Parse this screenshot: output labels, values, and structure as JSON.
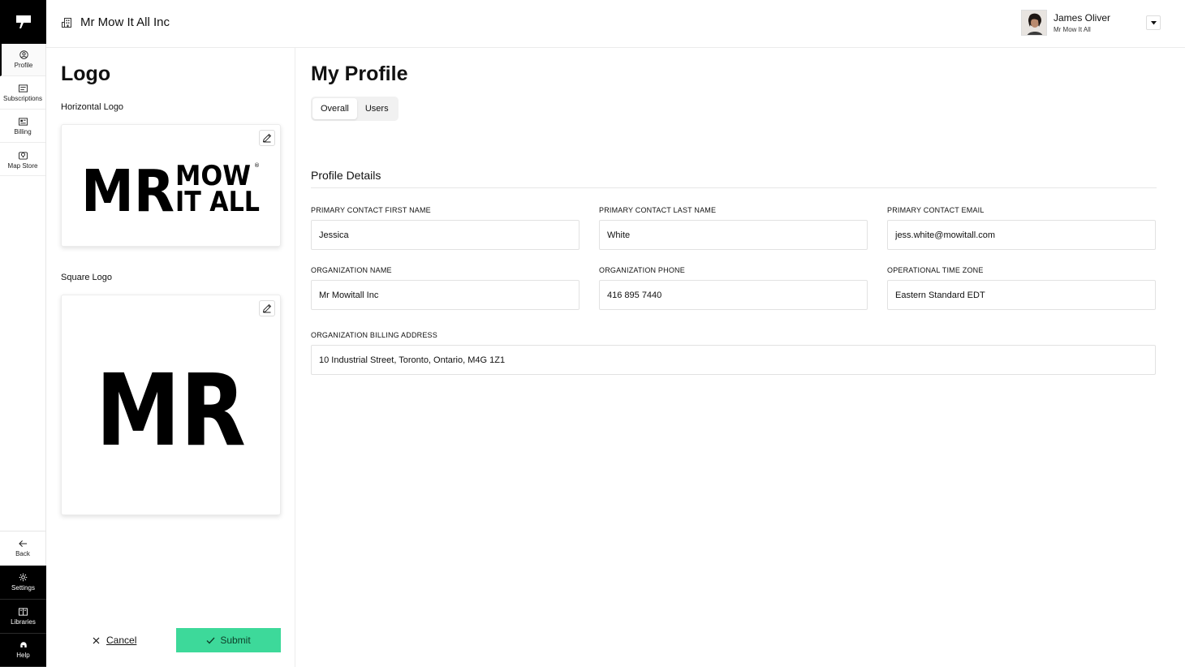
{
  "nav": {
    "items": [
      {
        "label": "Profile",
        "icon": "user-circle-icon"
      },
      {
        "label": "Subscriptions",
        "icon": "list-icon"
      },
      {
        "label": "Billing",
        "icon": "billing-icon"
      },
      {
        "label": "Map Store",
        "icon": "map-pin-icon"
      }
    ],
    "back_label": "Back",
    "bottom": [
      {
        "label": "Settings",
        "icon": "gear-icon"
      },
      {
        "label": "Libraries",
        "icon": "book-icon"
      },
      {
        "label": "Help",
        "icon": "help-icon"
      }
    ]
  },
  "header": {
    "org_name": "Mr Mow It All Inc",
    "user_name": "James Oliver",
    "user_org": "Mr Mow It All"
  },
  "logo_panel": {
    "title": "Logo",
    "horizontal_label": "Horizontal Logo",
    "square_label": "Square Logo",
    "horizontal_logo_text": [
      "MR",
      "MOW",
      "IT ALL",
      "®"
    ],
    "square_logo_text": "MR",
    "cancel_label": "Cancel",
    "submit_label": "Submit"
  },
  "profile": {
    "title": "My Profile",
    "tabs": [
      "Overall",
      "Users"
    ],
    "active_tab": "Overall",
    "section_title": "Profile Details",
    "fields": {
      "first_name": {
        "label": "PRIMARY CONTACT FIRST NAME",
        "value": "Jessica"
      },
      "last_name": {
        "label": "PRIMARY CONTACT LAST NAME",
        "value": "White"
      },
      "email": {
        "label": "PRIMARY CONTACT EMAIL",
        "value": "jess.white@mowitall.com"
      },
      "org_name": {
        "label": "ORGANIZATION NAME",
        "value": "Mr Mowitall Inc"
      },
      "org_phone": {
        "label": "ORGANIZATION PHONE",
        "value": "416 895 7440"
      },
      "timezone": {
        "label": "OPERATIONAL TIME ZONE",
        "value": "Eastern Standard EDT"
      },
      "billing_address": {
        "label": "ORGANIZATION BILLING ADDRESS",
        "value": "10 Industrial Street, Toronto, Ontario, M4G 1Z1"
      }
    }
  },
  "colors": {
    "submit": "#3dd99a",
    "rail_dark": "#000000"
  }
}
